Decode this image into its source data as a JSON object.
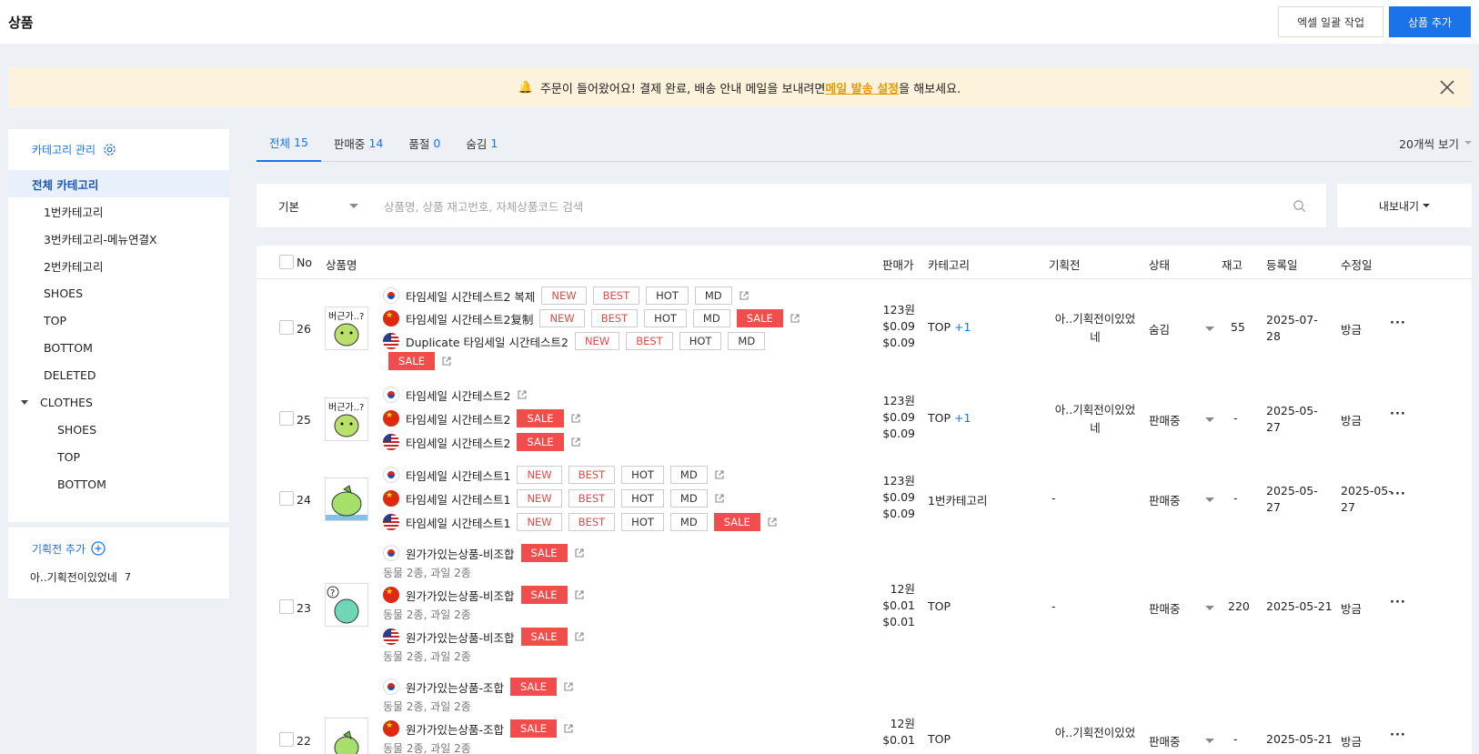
{
  "header": {
    "title": "상품",
    "excel_label": "엑셀 일괄 작업",
    "add_label": "상품 추가"
  },
  "notice": {
    "before": "주문이 들어왔어요! 결제 완료, 배송 안내 메일을 보내려면 ",
    "link": "메일 발송 설정",
    "after": "을 해보세요."
  },
  "sidebar": {
    "manage_label": "카테고리 관리",
    "items": [
      {
        "label": "전체 카테고리"
      },
      {
        "label": "1번카테고리"
      },
      {
        "label": "3번카테고리-메뉴연결X"
      },
      {
        "label": "2번카테고리"
      },
      {
        "label": "SHOES"
      },
      {
        "label": "TOP"
      },
      {
        "label": "BOTTOM"
      },
      {
        "label": "DELETED"
      },
      {
        "label": "CLOTHES"
      },
      {
        "label": "SHOES"
      },
      {
        "label": "TOP"
      },
      {
        "label": "BOTTOM"
      }
    ],
    "plan_add_label": "기획전 추가",
    "plan_item": {
      "label": "아..기획전이있었네",
      "count": "7"
    }
  },
  "tabs": [
    {
      "label": "전체",
      "count": "15"
    },
    {
      "label": "판매중",
      "count": "14"
    },
    {
      "label": "품절",
      "count": "0"
    },
    {
      "label": "숨김",
      "count": "1"
    }
  ],
  "per_page": "20개씩 보기",
  "search": {
    "select_value": "기본",
    "placeholder": "상품명, 상품 재고번호, 자체상품코드 검색"
  },
  "export_label": "내보내기",
  "columns": {
    "no": "No",
    "name": "상품명",
    "price": "판매가",
    "category": "카테고리",
    "plan": "기획전",
    "status": "상태",
    "stock": "재고",
    "created": "등록일",
    "modified": "수정일"
  },
  "tags": {
    "new": "NEW",
    "best": "BEST",
    "hot": "HOT",
    "md": "MD",
    "sale": "SALE"
  },
  "rows": [
    {
      "no": "26",
      "names": [
        "타임세일 시간테스트2 복제",
        "타임세일 시간테스트2复制",
        "Duplicate 타임세일 시간테스트2"
      ],
      "prices": [
        "123원",
        "$0.09",
        "$0.09"
      ],
      "category": "TOP",
      "category_extra": "+1",
      "plan_1": "아..기획전이있었",
      "plan_2": "네",
      "status": "숨김",
      "stock": "55",
      "created_1": "2025-07-",
      "created_2": "28",
      "modified": "방금"
    },
    {
      "no": "25",
      "names": [
        "타임세일 시간테스트2",
        "타임세일 시간테스트2",
        "타임세일 시간테스트2"
      ],
      "prices": [
        "123원",
        "$0.09",
        "$0.09"
      ],
      "category": "TOP",
      "category_extra": "+1",
      "plan_1": "아..기획전이있었",
      "plan_2": "네",
      "status": "판매중",
      "stock": "-",
      "created_1": "2025-05-",
      "created_2": "27",
      "modified": "방금"
    },
    {
      "no": "24",
      "names": [
        "타임세일 시간테스트1",
        "타임세일 시간테스트1",
        "타임세일 시간테스트1"
      ],
      "prices": [
        "123원",
        "$0.09",
        "$0.09"
      ],
      "category": "1번카테고리",
      "plan": "-",
      "status": "판매중",
      "stock": "-",
      "created_1": "2025-05-",
      "created_2": "27",
      "modified_1": "2025-05-",
      "modified_2": "27"
    },
    {
      "no": "23",
      "names": [
        "원가가있는상품-비조합",
        "원가가있는상품-비조합",
        "원가가있는상품-비조합"
      ],
      "sub": "동물 2종, 과일 2종",
      "prices": [
        "12원",
        "$0.01",
        "$0.01"
      ],
      "category": "TOP",
      "plan": "-",
      "status": "판매중",
      "stock": "220",
      "created": "2025-05-21",
      "modified": "방금"
    },
    {
      "no": "22",
      "names": [
        "원가가있는상품-조합",
        "원가가있는상품-조합"
      ],
      "sub": "동물 2종, 과일 2종",
      "prices": [
        "12원",
        "$0.01"
      ],
      "category": "TOP",
      "plan_1": "아..기획전이있었",
      "status": "판매중",
      "stock": "-",
      "created": "2025-05-21",
      "modified": "방금"
    }
  ]
}
